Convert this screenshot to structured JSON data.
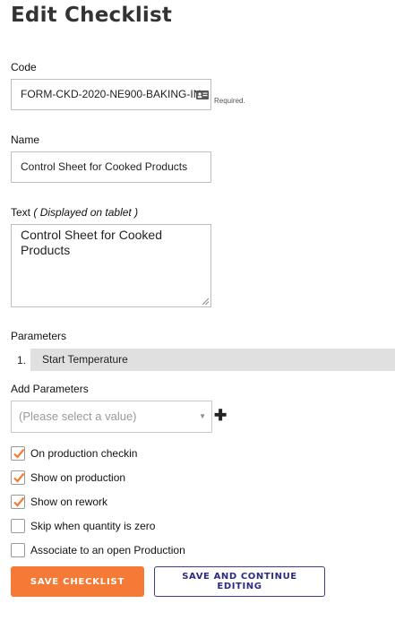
{
  "page": {
    "title": "Edit Checklist"
  },
  "code": {
    "label": "Code",
    "value": "FORM-CKD-2020-NE900-BAKING-IN",
    "required_note": "Required.",
    "icon": "id-card-icon"
  },
  "name": {
    "label": "Name",
    "value": "Control Sheet for Cooked Products"
  },
  "text": {
    "label": "Text",
    "label_note": "( Displayed on tablet )",
    "value": "Control Sheet for Cooked Products"
  },
  "parameters": {
    "label": "Parameters",
    "items": [
      {
        "number": "1.",
        "name": "Start Temperature"
      }
    ]
  },
  "add_parameters": {
    "label": "Add Parameters",
    "placeholder": "(Please select a value)",
    "add_icon": "plus-icon"
  },
  "options": [
    {
      "label": "On production checkin",
      "checked": true
    },
    {
      "label": "Show on production",
      "checked": true
    },
    {
      "label": "Show on rework",
      "checked": true
    },
    {
      "label": "Skip when quantity is zero",
      "checked": false
    },
    {
      "label": "Associate to an open Production",
      "checked": false
    }
  ],
  "buttons": {
    "save": "SAVE CHECKLIST",
    "save_continue": "SAVE AND CONTINUE EDITING"
  },
  "colors": {
    "accent": "#f47a36",
    "secondary": "#2d2c7a",
    "param_bg": "#e0e0e0"
  }
}
